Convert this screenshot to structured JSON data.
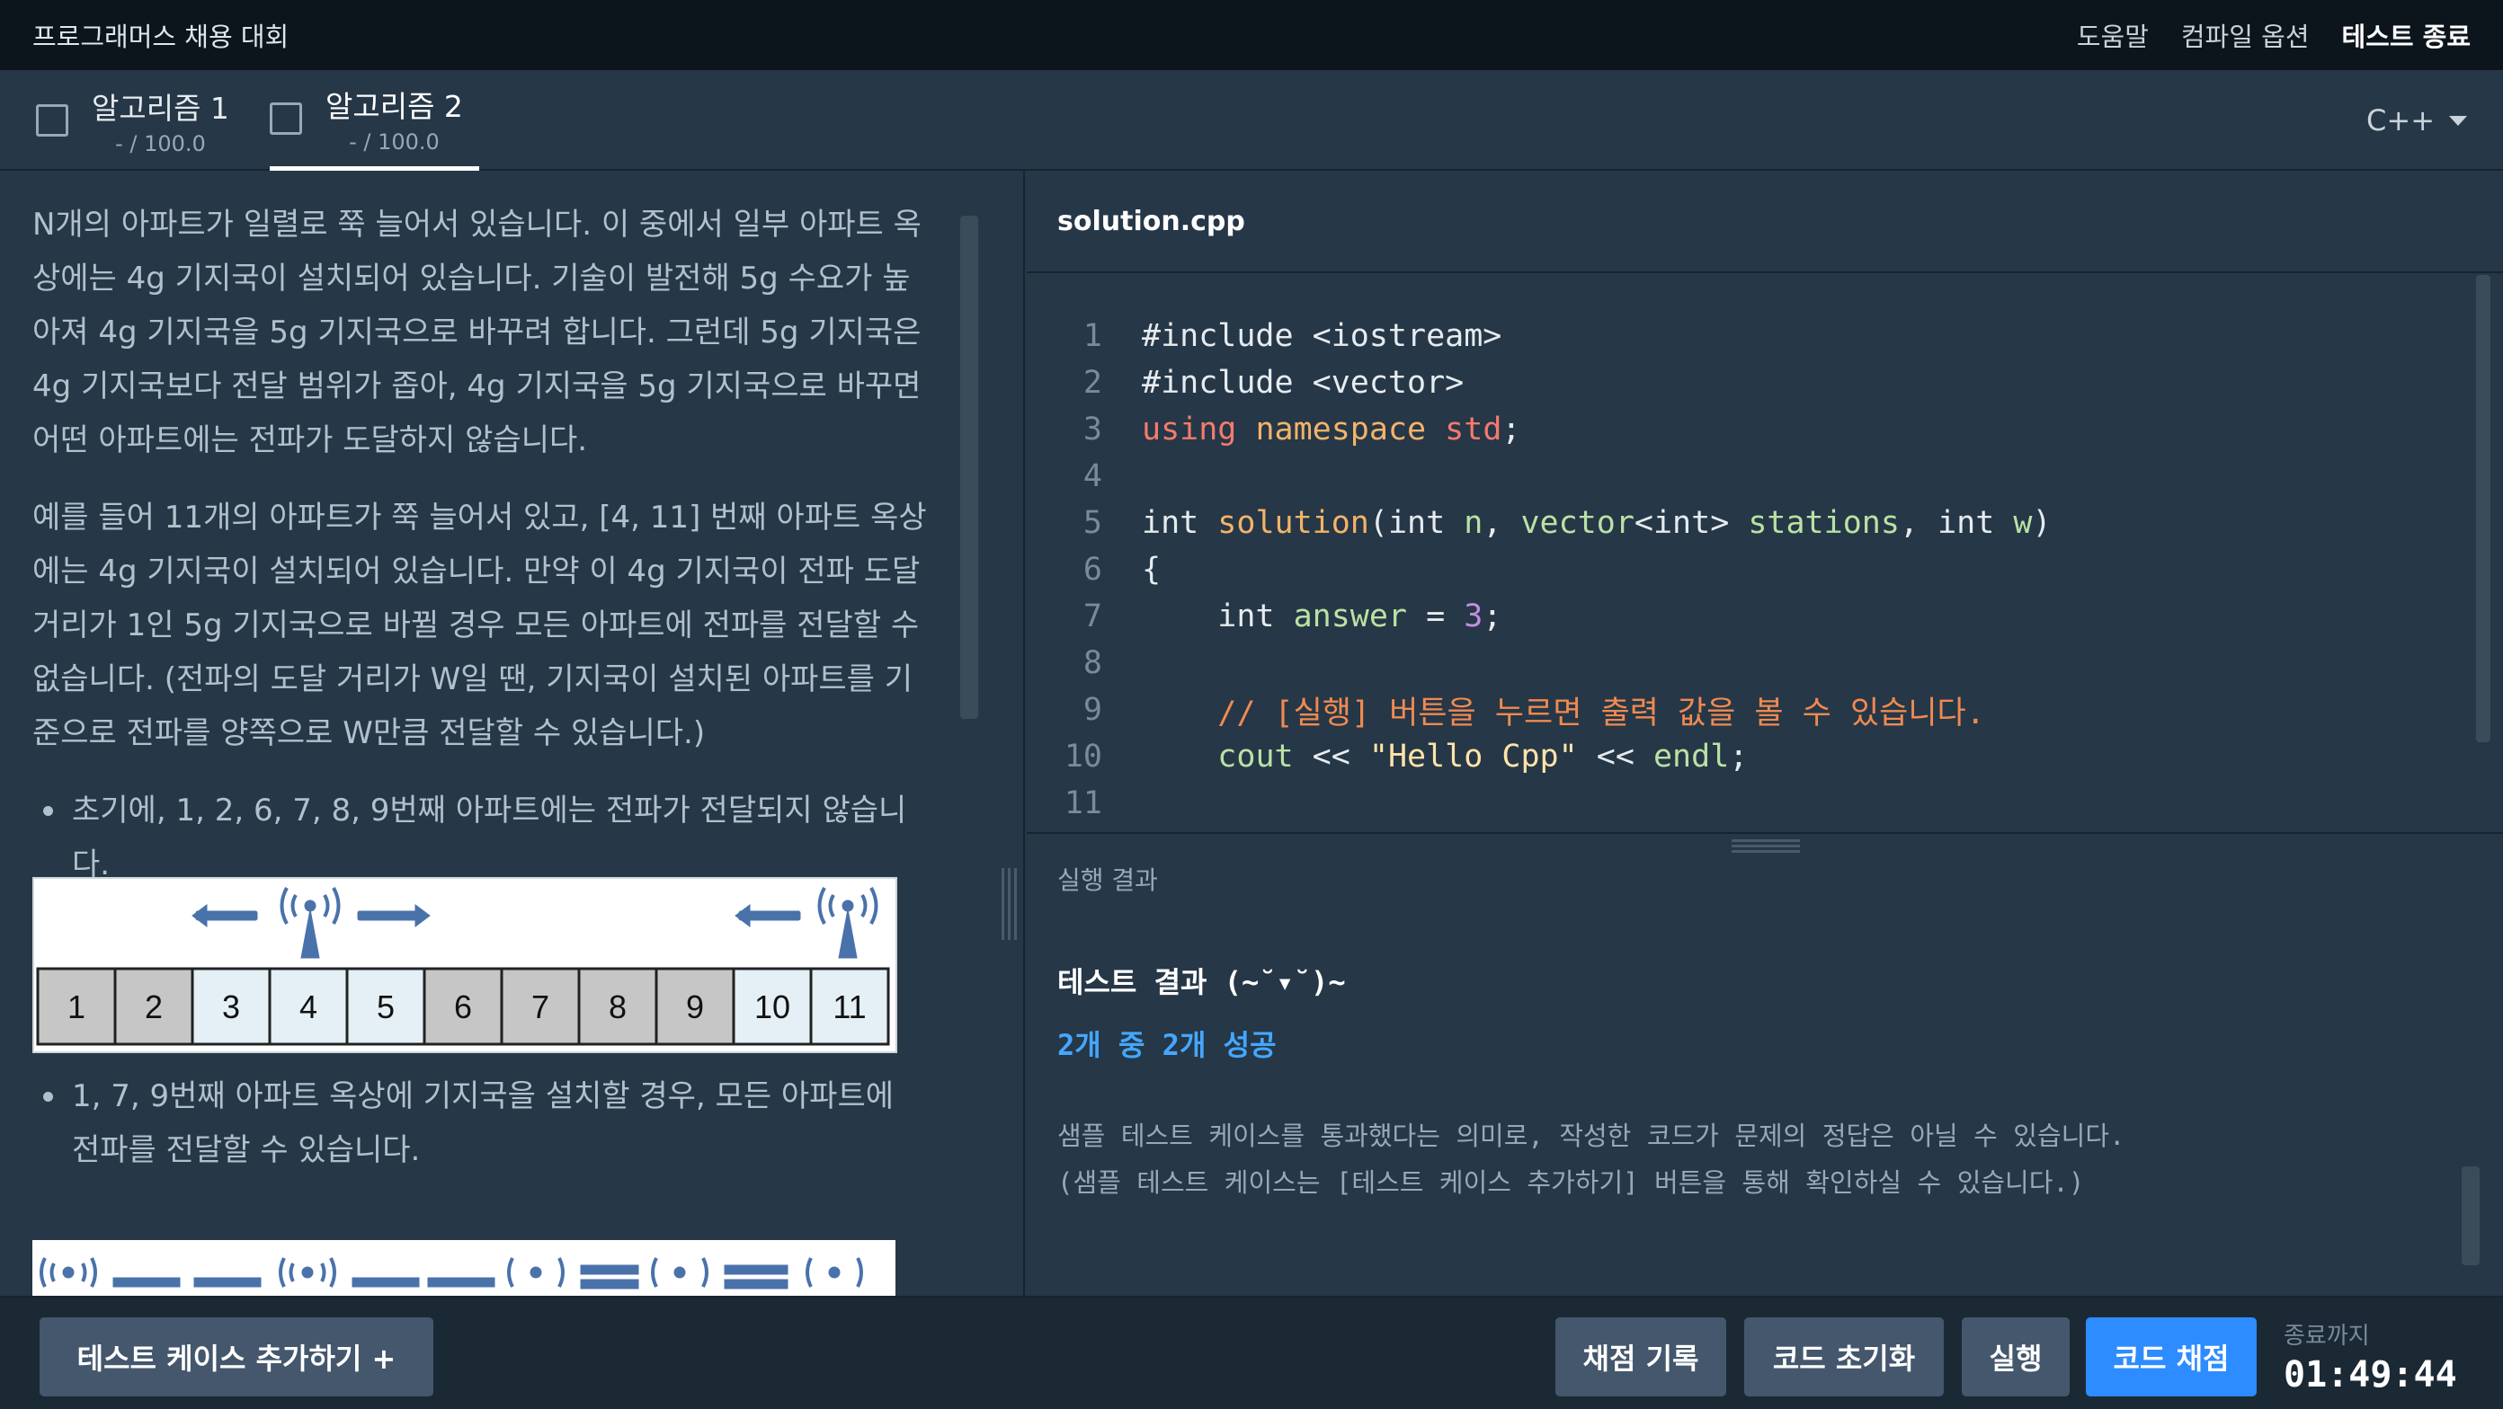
{
  "header": {
    "title": "프로그래머스 채용 대회",
    "menu": {
      "help": "도움말",
      "compile_options": "컴파일 옵션",
      "end_test": "테스트 종료"
    }
  },
  "tabs": [
    {
      "label": "알고리즘 1",
      "score": "- / 100.0"
    },
    {
      "label": "알고리즘 2",
      "score": "- / 100.0"
    }
  ],
  "language": "C++",
  "problem": {
    "para1": "N개의 아파트가 일렬로 쭉 늘어서 있습니다. 이 중에서 일부 아파트 옥상에는 4g 기지국이 설치되어 있습니다. 기술이 발전해 5g 수요가 높아져 4g 기지국을 5g 기지국으로 바꾸려 합니다. 그런데 5g 기지국은 4g 기지국보다 전달 범위가 좁아, 4g 기지국을 5g 기지국으로 바꾸면 어떤 아파트에는 전파가 도달하지 않습니다.",
    "para2": "예를 들어 11개의 아파트가 쭉 늘어서 있고, [4, 11] 번째 아파트 옥상에는 4g 기지국이 설치되어 있습니다. 만약 이 4g 기지국이 전파 도달 거리가 1인 5g 기지국으로 바뀔 경우 모든 아파트에 전파를 전달할 수 없습니다. (전파의 도달 거리가 W일 땐, 기지국이 설치된 아파트를 기준으로 전파를 양쪽으로 W만큼 전달할 수 있습니다.)",
    "bullet1": "초기에, 1, 2, 6, 7, 8, 9번째 아파트에는 전파가 전달되지 않습니다.",
    "bullet2": "1, 7, 9번째 아파트 옥상에 기지국을 설치할 경우, 모든 아파트에 전파를 전달할 수 있습니다.",
    "figure1_cells": [
      "1",
      "2",
      "3",
      "4",
      "5",
      "6",
      "7",
      "8",
      "9",
      "10",
      "11"
    ],
    "figure1_covered": [
      false,
      false,
      true,
      true,
      true,
      false,
      false,
      false,
      false,
      true,
      true
    ]
  },
  "editor": {
    "filename": "solution.cpp",
    "line_numbers": [
      "1",
      "2",
      "3",
      "4",
      "5",
      "6",
      "7",
      "8",
      "9",
      "10",
      "11"
    ]
  },
  "result": {
    "title": "실행 결과",
    "line1": "테스트 결과 (~˘▾˘)~",
    "line2": "2개 중 2개 성공",
    "line3": "샘플 테스트 케이스를 통과했다는 의미로, 작성한 코드가 문제의 정답은 아닐 수 있습니다.",
    "line4": "(샘플 테스트 케이스는 [테스트 케이스 추가하기] 버튼을 통해 확인하실 수 있습니다.)"
  },
  "bottom": {
    "add_test_case": "테스트 케이스 추가하기 +",
    "grading_history": "채점 기록",
    "reset_code": "코드 초기화",
    "run": "실행",
    "submit": "코드 채점",
    "timer_label": "종료까지",
    "timer_value": "01:49:44"
  },
  "colors": {
    "accent": "#2d8cff",
    "success_text": "#44a7ff",
    "background": "#263747",
    "topbar": "#0c151c"
  }
}
